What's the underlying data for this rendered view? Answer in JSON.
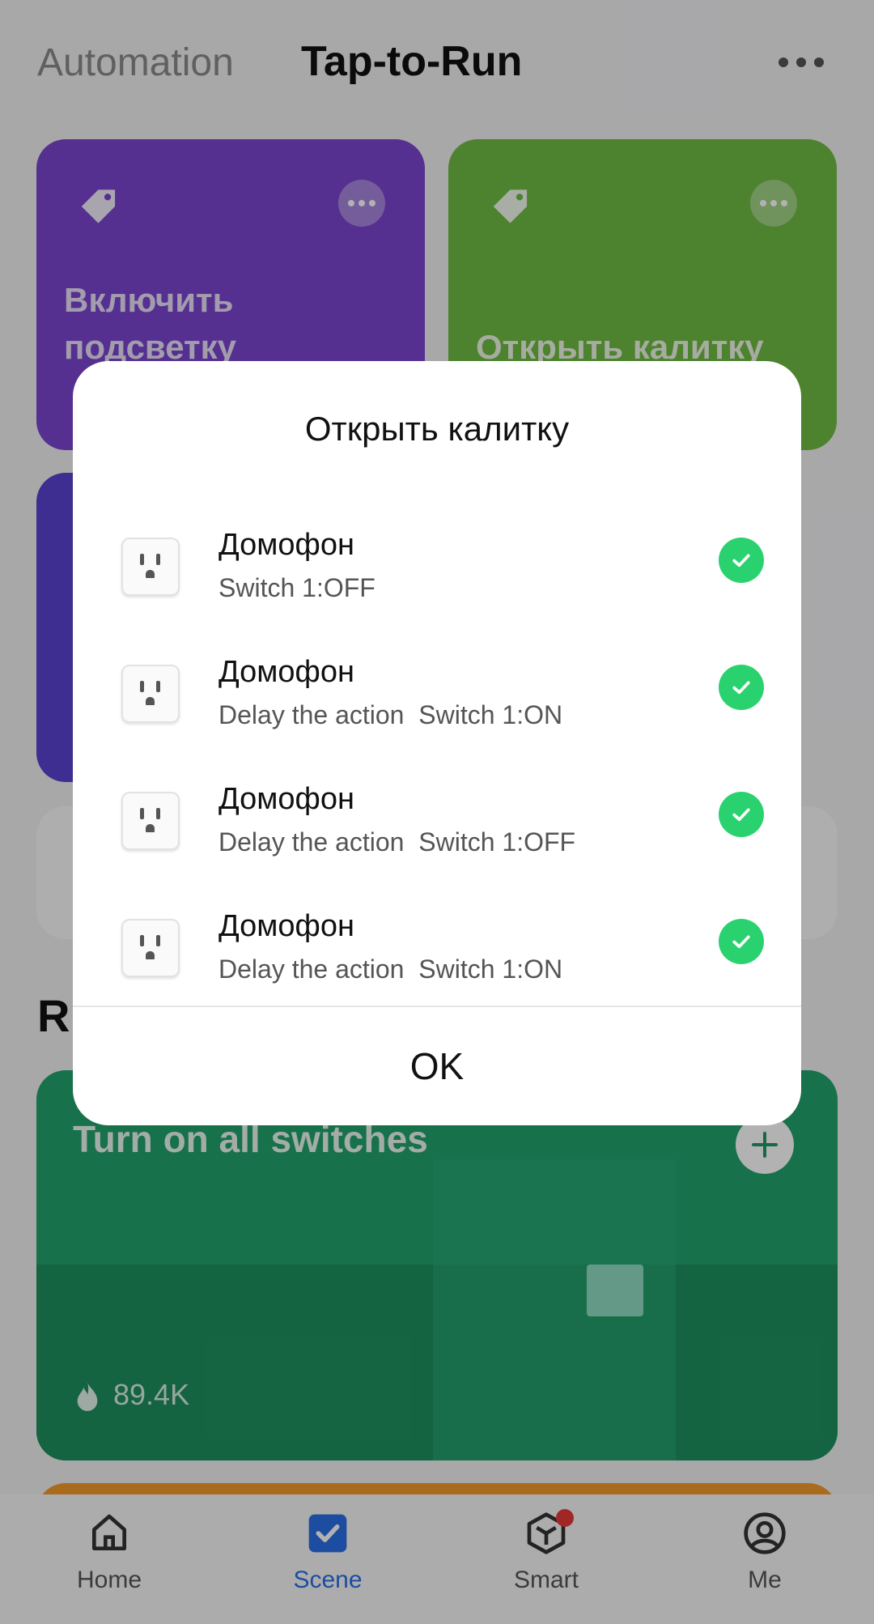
{
  "header": {
    "tab_automation": "Automation",
    "tab_tap_to_run": "Tap-to-Run",
    "more_icon": "more-horizontal-icon"
  },
  "scenes": [
    {
      "title_line1": "Включить",
      "title_line2": "подсветку",
      "color": "#7a46cf"
    },
    {
      "title_line1": "Открыть калитку",
      "color": "#6fbb43"
    },
    {
      "color": "#5a43d0"
    }
  ],
  "recommended": {
    "card_title": "Turn on all switches",
    "count": "89.4K",
    "color": "#21a36c"
  },
  "dialog": {
    "title": "Открыть калитку",
    "items": [
      {
        "name": "Домофон",
        "desc": "Switch 1:OFF",
        "checked": true
      },
      {
        "name": "Домофон",
        "desc": "Delay the action  Switch 1:ON",
        "checked": true
      },
      {
        "name": "Домофон",
        "desc": "Delay the action  Switch 1:OFF",
        "checked": true
      },
      {
        "name": "Домофон",
        "desc": "Delay the action  Switch 1:ON",
        "checked": true
      }
    ],
    "ok_label": "OK",
    "check_color": "#2ad26f"
  },
  "bottom_nav": {
    "items": [
      {
        "label": "Home",
        "icon": "home-icon"
      },
      {
        "label": "Scene",
        "icon": "scene-check-icon",
        "active": true
      },
      {
        "label": "Smart",
        "icon": "smart-cube-icon",
        "badge": true
      },
      {
        "label": "Me",
        "icon": "user-icon"
      }
    ],
    "active_color": "#2a6fe6"
  }
}
